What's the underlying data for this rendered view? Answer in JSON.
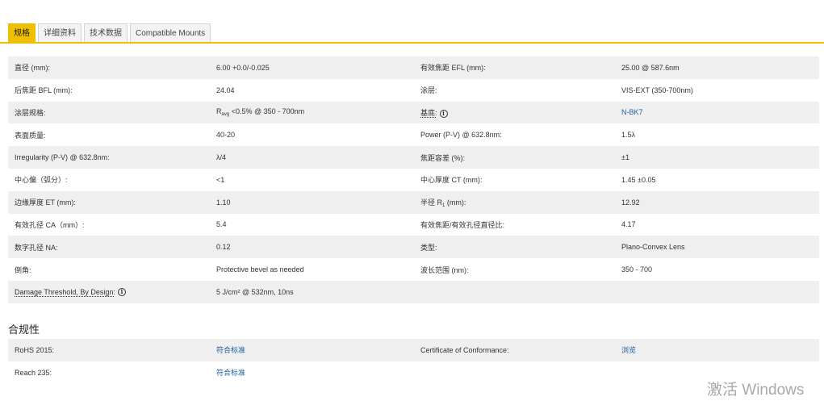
{
  "tabs": [
    {
      "label": "规格",
      "active": true
    },
    {
      "label": "详细资料",
      "active": false
    },
    {
      "label": "技术数据",
      "active": false
    },
    {
      "label": "Compatible Mounts",
      "active": false
    }
  ],
  "specs": {
    "diameter": {
      "label": "直径 (mm):",
      "value": "6.00 +0.0/-0.025"
    },
    "efl": {
      "label": "有效焦距 EFL (mm):",
      "value": "25.00 @ 587.6nm"
    },
    "bfl": {
      "label": "后焦距 BFL (mm):",
      "value": "24.04"
    },
    "coating": {
      "label": "涂层:",
      "value": "VIS-EXT (350-700nm)"
    },
    "coating_spec": {
      "label": "涂层规格:",
      "value_r": "R",
      "value_sub": "avg",
      "value_rest": " <0.5% @ 350 - 700nm"
    },
    "substrate": {
      "label": "基底:",
      "info": "i",
      "value": "N-BK7"
    },
    "surface_quality": {
      "label": "表面质量:",
      "value": "40-20"
    },
    "power": {
      "label": "Power (P-V) @ 632.8nm:",
      "value": "1.5λ"
    },
    "irregularity": {
      "label": "Irregularity (P-V) @ 632.8nm:",
      "value": "λ/4"
    },
    "focal_tolerance": {
      "label": "焦距容差 (%):",
      "value": "±1"
    },
    "centering": {
      "label": "中心偏（弧分）:",
      "value": "<1"
    },
    "ct": {
      "label": "中心厚度 CT (mm):",
      "value": "1.45 ±0.05"
    },
    "et": {
      "label": "边缘厚度 ET (mm):",
      "value": "1.10"
    },
    "radius": {
      "label_pre": "半径 R",
      "label_sub": "1",
      "label_post": " (mm):",
      "value": "12.92"
    },
    "ca": {
      "label": "有效孔径 CA（mm）:",
      "value": "5.4"
    },
    "f_number": {
      "label": "有效焦距/有效孔径直径比:",
      "value": "4.17"
    },
    "na": {
      "label": "数字孔径 NA:",
      "value": "0.12"
    },
    "type": {
      "label": "类型:",
      "value": "Plano-Convex Lens"
    },
    "bevel": {
      "label": "倒角:",
      "value": "Protective bevel as needed"
    },
    "wavelength": {
      "label": "波长范围 (nm):",
      "value": "350 - 700"
    },
    "damage": {
      "label": "Damage Threshold, By Design:",
      "info": "i",
      "value": "5 J/cm² @ 532nm, 10ns"
    }
  },
  "compliance": {
    "title": "合规性",
    "rohs": {
      "label": "RoHS 2015:",
      "value": "符合标准"
    },
    "coc": {
      "label": "Certificate of Conformance:",
      "value": "浏览"
    },
    "reach": {
      "label": "Reach 235:",
      "value": "符合标准"
    }
  },
  "watermark": "激活 Windows",
  "colors": {
    "accent": "#f0c000",
    "link": "#1f5f9f",
    "row_alt": "#efefef"
  }
}
